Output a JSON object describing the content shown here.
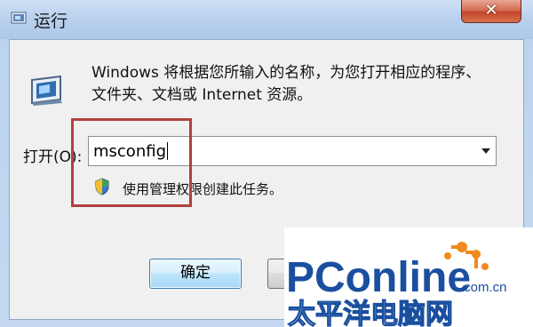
{
  "window": {
    "title": "运行",
    "close_icon": "close-icon",
    "close_glyph": "✕"
  },
  "dialog": {
    "description_line1": "Windows 将根据您所输入的名称，为您打开相应的程序、",
    "description_line2": "文件夹、文档或 Internet 资源。",
    "open_label": "打开(O):",
    "open_value": "msconfig",
    "admin_note": "使用管理权限创建此任务。",
    "ok_label": "确定",
    "icons": [
      "run-icon",
      "uac-shield-icon",
      "dropdown-arrow-icon"
    ]
  },
  "watermark": {
    "brand": "PConline",
    "domain": ".com.cn",
    "chinese": "太平洋电脑网"
  },
  "colors": {
    "highlight": "#b2403d",
    "title_bar": "#b9d0ee",
    "watermark_blue": "#1a4fa0",
    "watermark_orange": "#f08a1c"
  }
}
